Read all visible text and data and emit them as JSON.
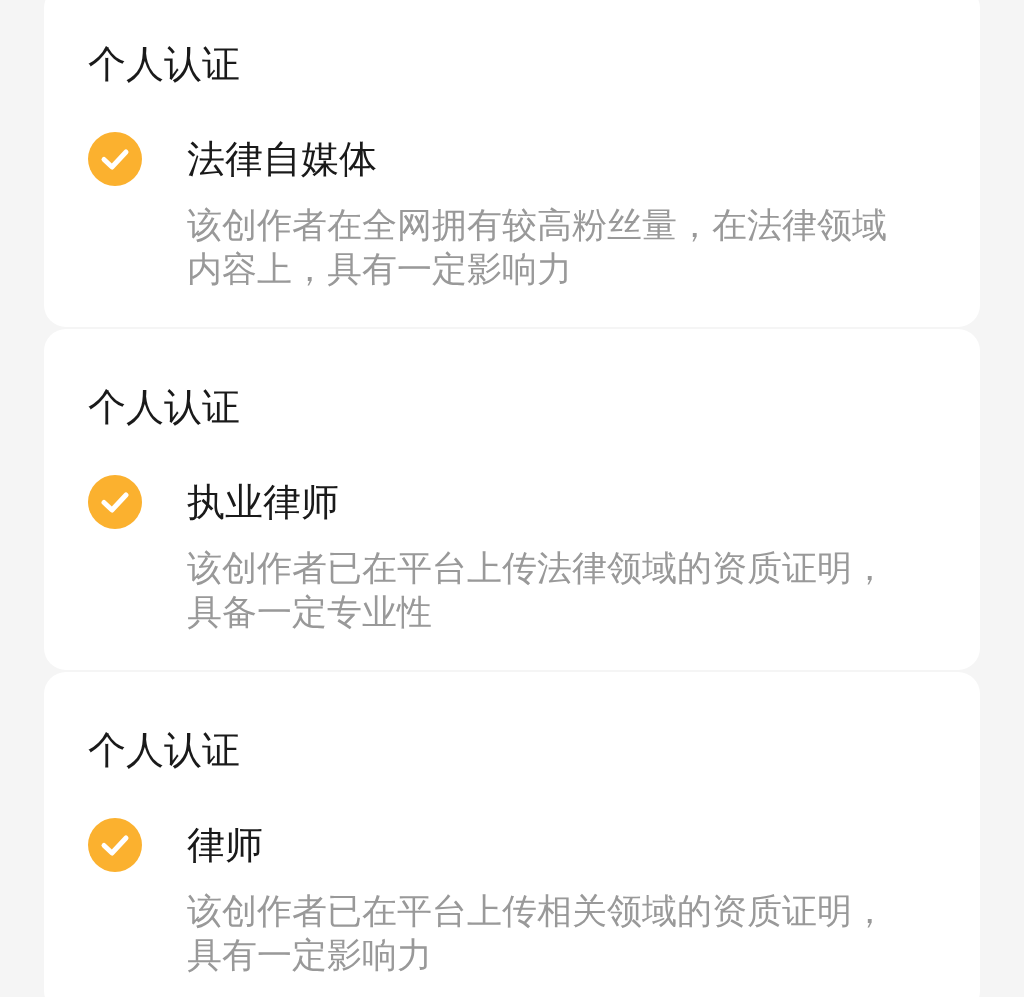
{
  "cards": [
    {
      "heading": "个人认证",
      "badge": {
        "verified": true,
        "title": "法律自媒体",
        "description": "该创作者在全网拥有较高粉丝量，在法律领域内容上，具有一定影响力"
      }
    },
    {
      "heading": "个人认证",
      "badge": {
        "verified": true,
        "title": "执业律师",
        "description": "该创作者已在平台上传法律领域的资质证明，具备一定专业性"
      }
    },
    {
      "heading": "个人认证",
      "badge": {
        "verified": true,
        "title": "律师",
        "description": "该创作者已在平台上传相关领域的资质证明，具有一定影响力"
      }
    }
  ]
}
